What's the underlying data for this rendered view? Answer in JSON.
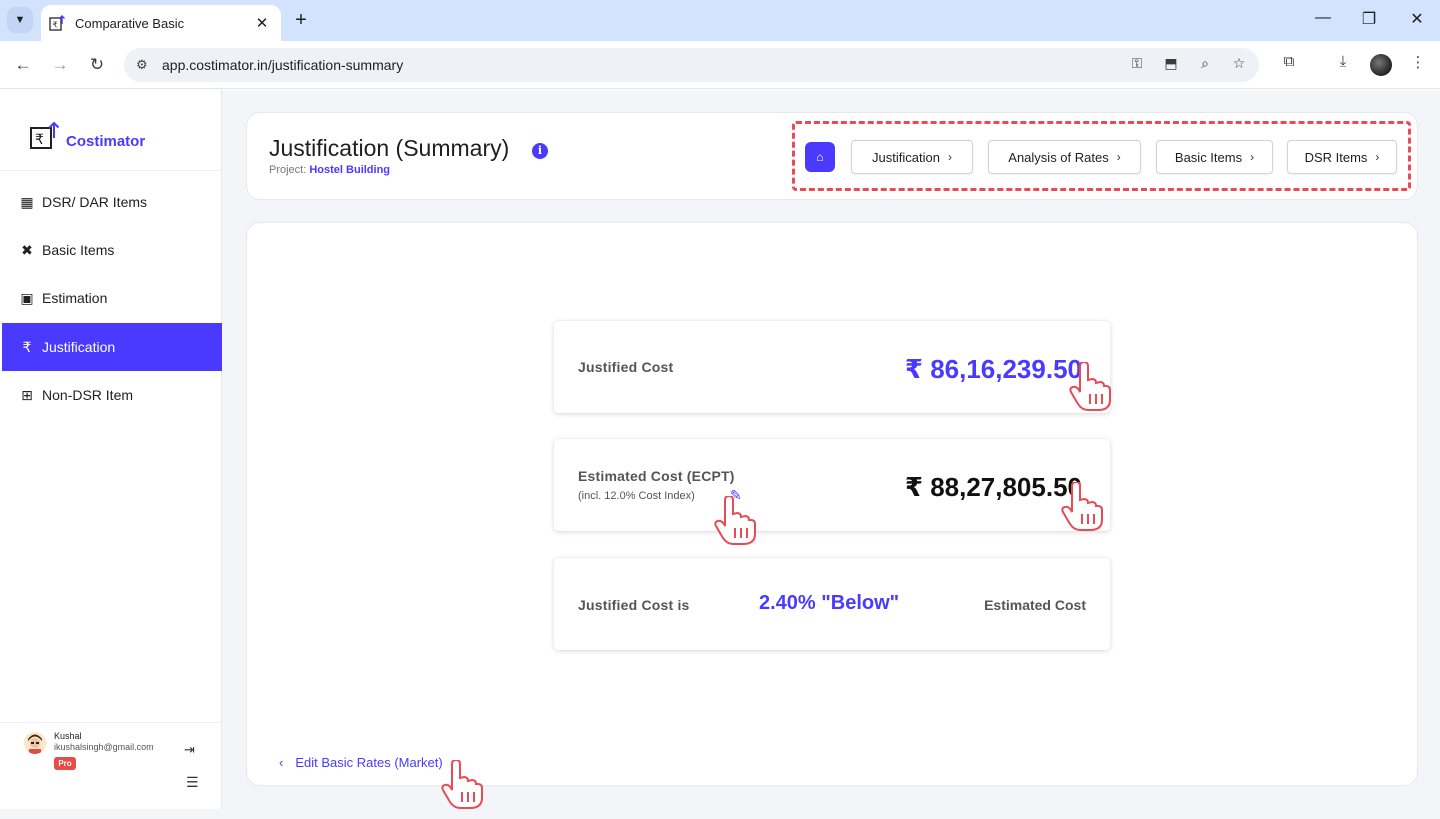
{
  "browser": {
    "tab_title": "Comparative Basic",
    "url": "app.costimator.in/justification-summary",
    "icons": [
      "chevron-down-icon",
      "close-icon",
      "plus-icon",
      "minimize-icon",
      "restore-icon",
      "close-window-icon",
      "back-icon",
      "forward-icon",
      "reload-icon",
      "key-icon",
      "install-icon",
      "zoom-icon",
      "star-icon",
      "extensions-icon",
      "download-icon",
      "menu-icon"
    ]
  },
  "sidebar": {
    "brand": "Costimator",
    "items": [
      {
        "label": "DSR/ DAR Items",
        "icon": "table-icon",
        "active": false
      },
      {
        "label": "Basic Items",
        "icon": "tools-icon",
        "active": false
      },
      {
        "label": "Estimation",
        "icon": "calculator-icon",
        "active": false
      },
      {
        "label": "Justification",
        "icon": "rupee-icon",
        "active": true
      },
      {
        "label": "Non-DSR Item",
        "icon": "add-box-icon",
        "active": false
      }
    ],
    "user": {
      "name": "Kushal",
      "email": "ikushalsingh@gmail.com",
      "badge": "Pro"
    }
  },
  "header": {
    "title": "Justification (Summary)",
    "project_label": "Project:",
    "project_name": "Hostel Building",
    "breadcrumbs": [
      "Justification",
      "Analysis of Rates",
      "Basic Items",
      "DSR Items"
    ]
  },
  "summary": {
    "justified_label": "Justified Cost",
    "justified_value": "₹ 86,16,239.50",
    "estimated_label": "Estimated Cost (ECPT)",
    "estimated_sub": "(incl. 12.0% Cost Index)",
    "estimated_value": "₹ 88,27,805.50",
    "compare_left": "Justified Cost is",
    "compare_pct": "2.40% \"Below\"",
    "compare_right": "Estimated Cost"
  },
  "footer_link": "Edit Basic Rates (Market)",
  "colors": {
    "accent": "#4a3aff",
    "highlight_border": "#e84a56",
    "pro_badge": "#ea4b47"
  }
}
